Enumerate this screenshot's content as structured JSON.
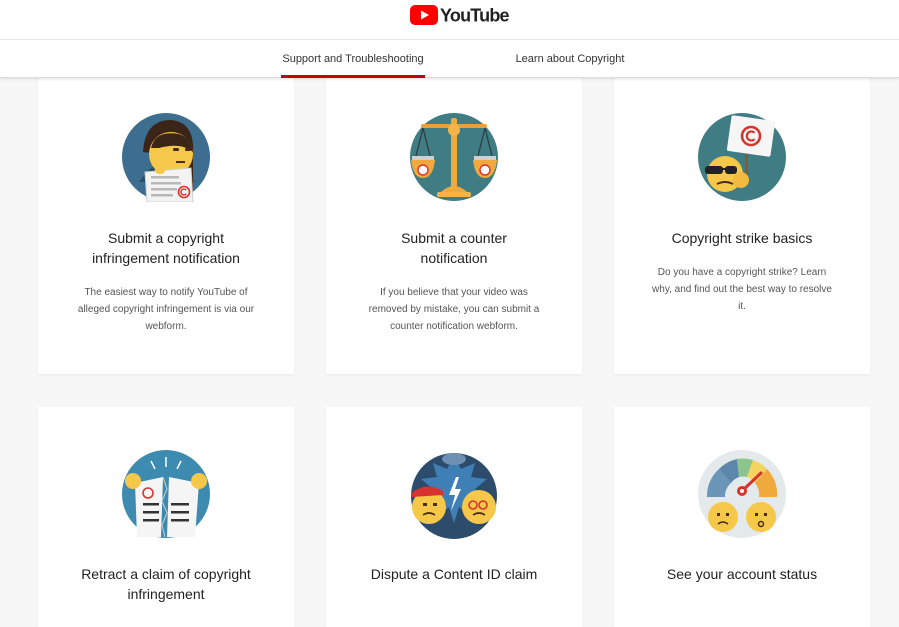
{
  "header": {
    "logo_text": "YouTube",
    "brand_color": "#ff0000"
  },
  "tabs": [
    {
      "label": "Support and Troubleshooting",
      "active": true
    },
    {
      "label": "Learn about Copyright",
      "active": false
    }
  ],
  "cards": [
    {
      "title": "Submit a copyright infringement notification",
      "description": "The easiest way to notify YouTube of alleged copyright infringement is via our webform.",
      "icon": "woman-with-copyright-notice-icon"
    },
    {
      "title": "Submit a counter notification",
      "description": "If you believe that your video was removed by mistake, you can submit a counter notification webform.",
      "icon": "scales-of-justice-icon"
    },
    {
      "title": "Copyright strike basics",
      "description": "Do you have a copyright strike? Learn why, and find out the best way to resolve it.",
      "icon": "copyright-strike-sign-icon"
    },
    {
      "title": "Retract a claim of copyright infringement",
      "description": "",
      "icon": "torn-paper-icon"
    },
    {
      "title": "Dispute a Content ID claim",
      "description": "",
      "icon": "dispute-faces-icon"
    },
    {
      "title": "See your account status",
      "description": "",
      "icon": "status-gauge-icon"
    }
  ],
  "colors": {
    "active_tab_underline": "#cc0000",
    "page_background": "#f7f7f7",
    "card_background": "#ffffff"
  }
}
